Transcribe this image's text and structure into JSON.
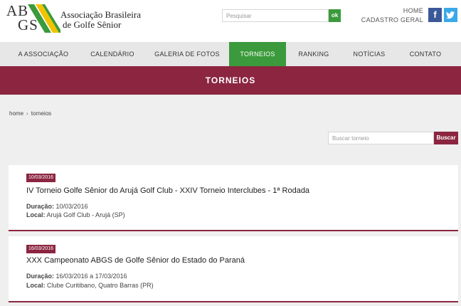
{
  "header": {
    "logo": {
      "ab": "AB",
      "gs": "GS",
      "line1": "Associação Brasileira",
      "line2": "de Golfe Sênior"
    },
    "search": {
      "placeholder": "Pesquisar",
      "button": "ok"
    },
    "links": {
      "home": "HOME",
      "cadastro": "CADASTRO GERAL"
    },
    "social": {
      "facebook": "f"
    }
  },
  "nav": {
    "items": [
      "A ASSOCIAÇÃO",
      "CALENDÁRIO",
      "GALERIA DE FOTOS",
      "TORNEIOS",
      "RANKING",
      "NOTÍCIAS",
      "CONTATO"
    ],
    "active": "TORNEIOS"
  },
  "banner": {
    "title": "TORNEIOS"
  },
  "breadcrumb": {
    "home": "home",
    "sep": "›",
    "current": "torneios"
  },
  "tournament_search": {
    "placeholder": "Buscar torneio",
    "button": "Buscar"
  },
  "tournaments": [
    {
      "date": "10/03/2016",
      "title": "IV Torneio Golfe Sênior do Arujá Golf Club - XXIV Torneio Interclubes - 1ª Rodada",
      "duracao_label": "Duração:",
      "duracao": "10/03/2016",
      "local_label": "Local:",
      "local": "Arujá Golf Club - Arujá (SP)"
    },
    {
      "date": "16/03/2016",
      "title": "XXX Campeonato ABGS de Golfe Sênior do Estado do Paraná",
      "duracao_label": "Duração:",
      "duracao": "16/03/2016 a 17/03/2016",
      "local_label": "Local:",
      "local": "Clube Curitibano, Quatro Barras (PR)"
    }
  ],
  "colors": {
    "brand_wine": "#8b2540",
    "brand_green": "#3b9a3b",
    "logo_yellow": "#f2c300",
    "facebook": "#3b5998",
    "twitter": "#3aa9e7"
  },
  "icons": [
    "facebook-icon",
    "twitter-icon",
    "chevron-right-icon"
  ]
}
